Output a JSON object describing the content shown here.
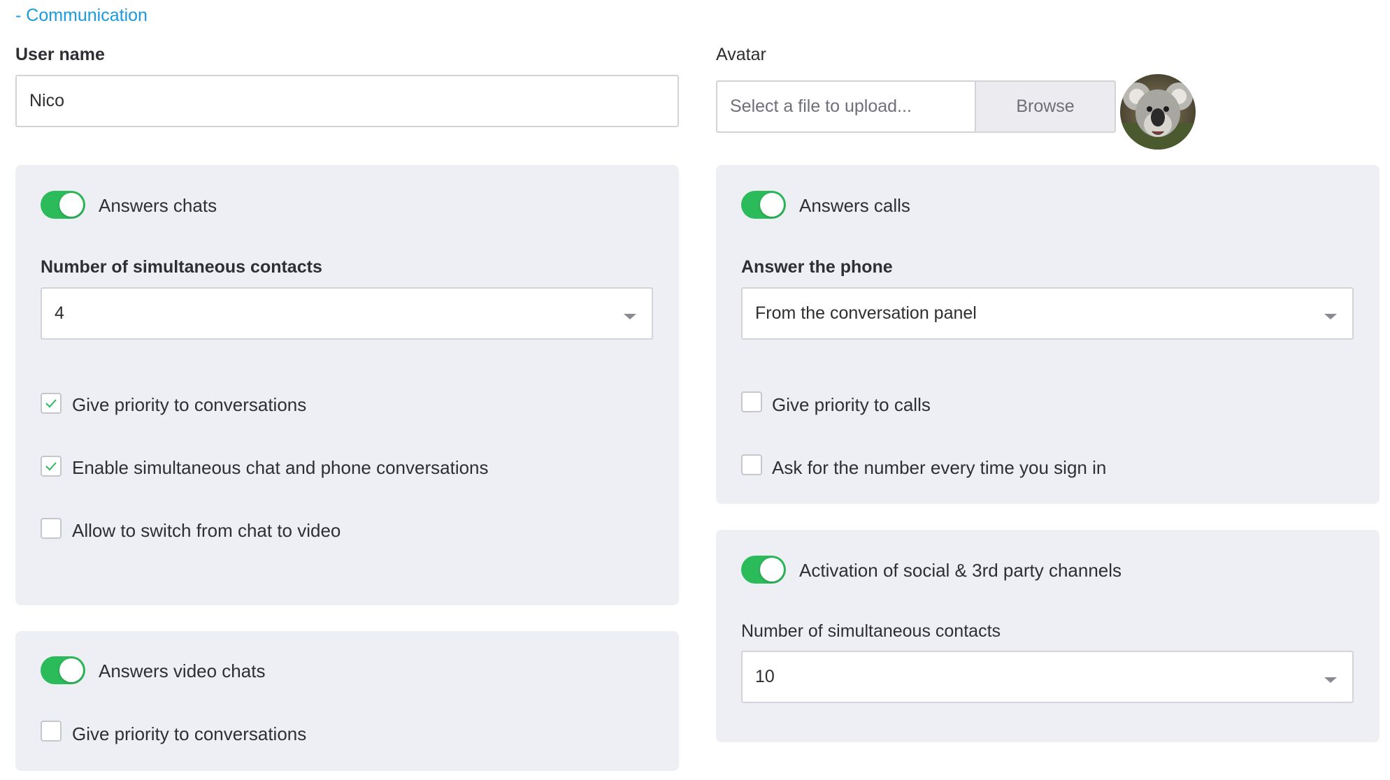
{
  "section": {
    "toggle_link": "- Communication"
  },
  "user": {
    "label": "User name",
    "value": "Nico"
  },
  "avatar": {
    "label": "Avatar",
    "file_placeholder": "Select a file to upload...",
    "browse_label": "Browse"
  },
  "chats_panel": {
    "toggle_label": "Answers chats",
    "toggle_on": true,
    "contacts_label": "Number of simultaneous contacts",
    "contacts_value": "4",
    "options": [
      {
        "label": "Give priority to conversations",
        "checked": true
      },
      {
        "label": "Enable simultaneous chat and phone conversations",
        "checked": true
      },
      {
        "label": "Allow to switch from chat to video",
        "checked": false
      }
    ]
  },
  "video_panel": {
    "toggle_label": "Answers video chats",
    "toggle_on": true,
    "options": [
      {
        "label": "Give priority to conversations",
        "checked": false
      }
    ]
  },
  "calls_panel": {
    "toggle_label": "Answers calls",
    "toggle_on": true,
    "phone_label": "Answer the phone",
    "phone_value": "From the conversation panel",
    "options": [
      {
        "label": "Give priority to calls",
        "checked": false
      },
      {
        "label": "Ask for the number every time you sign in",
        "checked": false
      }
    ]
  },
  "social_panel": {
    "toggle_label": "Activation of social & 3rd party channels",
    "toggle_on": true,
    "contacts_label": "Number of simultaneous contacts",
    "contacts_value": "10"
  },
  "colors": {
    "accent_link": "#1a9ae0",
    "toggle_on": "#2bbb5a",
    "check_mark": "#2bbb5a",
    "panel_bg": "#eeeff4"
  }
}
